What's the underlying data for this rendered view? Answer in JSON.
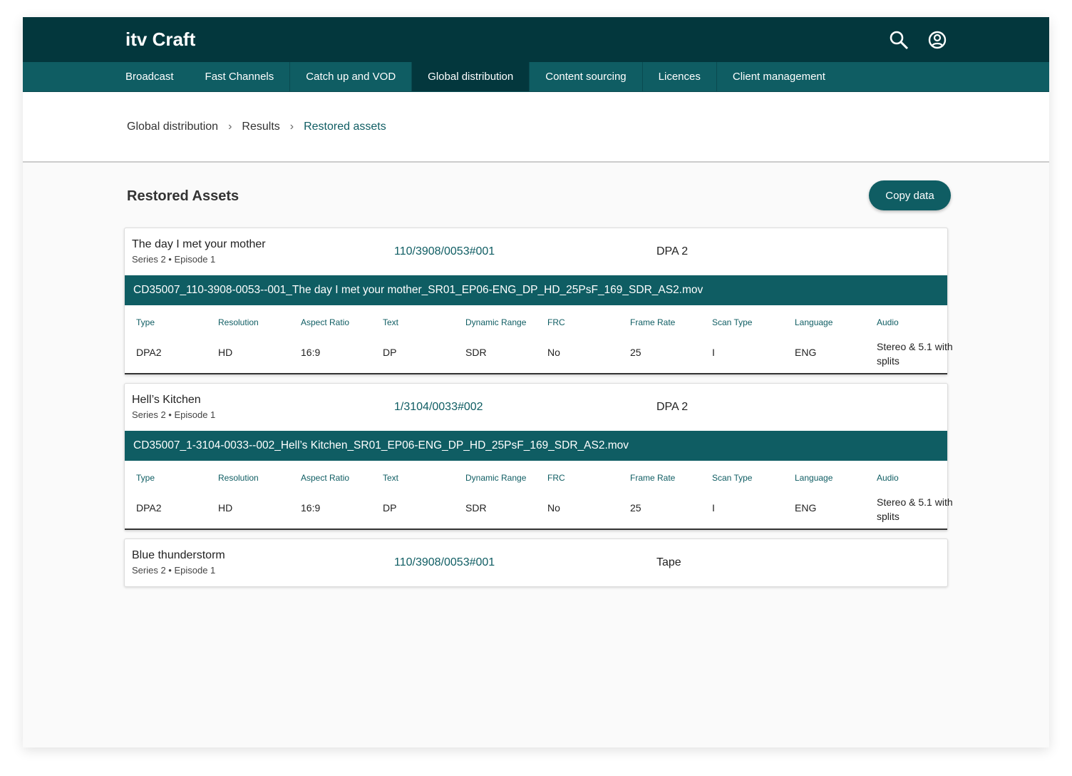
{
  "app": {
    "logo": "itv Craft",
    "icons": [
      "search-icon",
      "account-icon"
    ]
  },
  "nav": [
    {
      "label": "Broadcast"
    },
    {
      "label": "Fast Channels"
    },
    {
      "label": "Catch up and VOD"
    },
    {
      "label": "Global distribution",
      "active": true
    },
    {
      "label": "Content sourcing"
    },
    {
      "label": "Licences"
    },
    {
      "label": "Client management"
    }
  ],
  "breadcrumb": [
    "Global distribution",
    "Results",
    "Restored assets"
  ],
  "page": {
    "title": "Restored Assets",
    "copy_label": "Copy data"
  },
  "columns": [
    "Type",
    "Resolution",
    "Aspect Ratio",
    "Text",
    "Dynamic Range",
    "FRC",
    "Frame Rate",
    "Scan Type",
    "Language",
    "Audio"
  ],
  "assets": [
    {
      "title": "The day I met your mother",
      "sub": "Series 2 • Episode 1",
      "ref": "110/3908/0053#001",
      "format": "DPA 2",
      "file": "CD35007_110-3908-0053--001_The day I met your mother_SR01_EP06-ENG_DP_HD_25PsF_169_SDR_AS2.mov",
      "values": [
        "DPA2",
        "HD",
        "16:9",
        "DP",
        "SDR",
        "No",
        "25",
        "I",
        "ENG",
        "Stereo & 5.1 with splits"
      ]
    },
    {
      "title": "Hell’s Kitchen",
      "sub": "Series 2 • Episode 1",
      "ref": "1/3104/0033#002",
      "format": "DPA 2",
      "file": "CD35007_1-3104-0033--002_Hell’s Kitchen_SR01_EP06-ENG_DP_HD_25PsF_169_SDR_AS2.mov",
      "values": [
        "DPA2",
        "HD",
        "16:9",
        "DP",
        "SDR",
        "No",
        "25",
        "I",
        "ENG",
        "Stereo & 5.1 with splits"
      ]
    },
    {
      "title": "Blue thunderstorm",
      "sub": "Series 2 • Episode 1",
      "ref": "110/3908/0053#001",
      "format": "Tape"
    }
  ]
}
